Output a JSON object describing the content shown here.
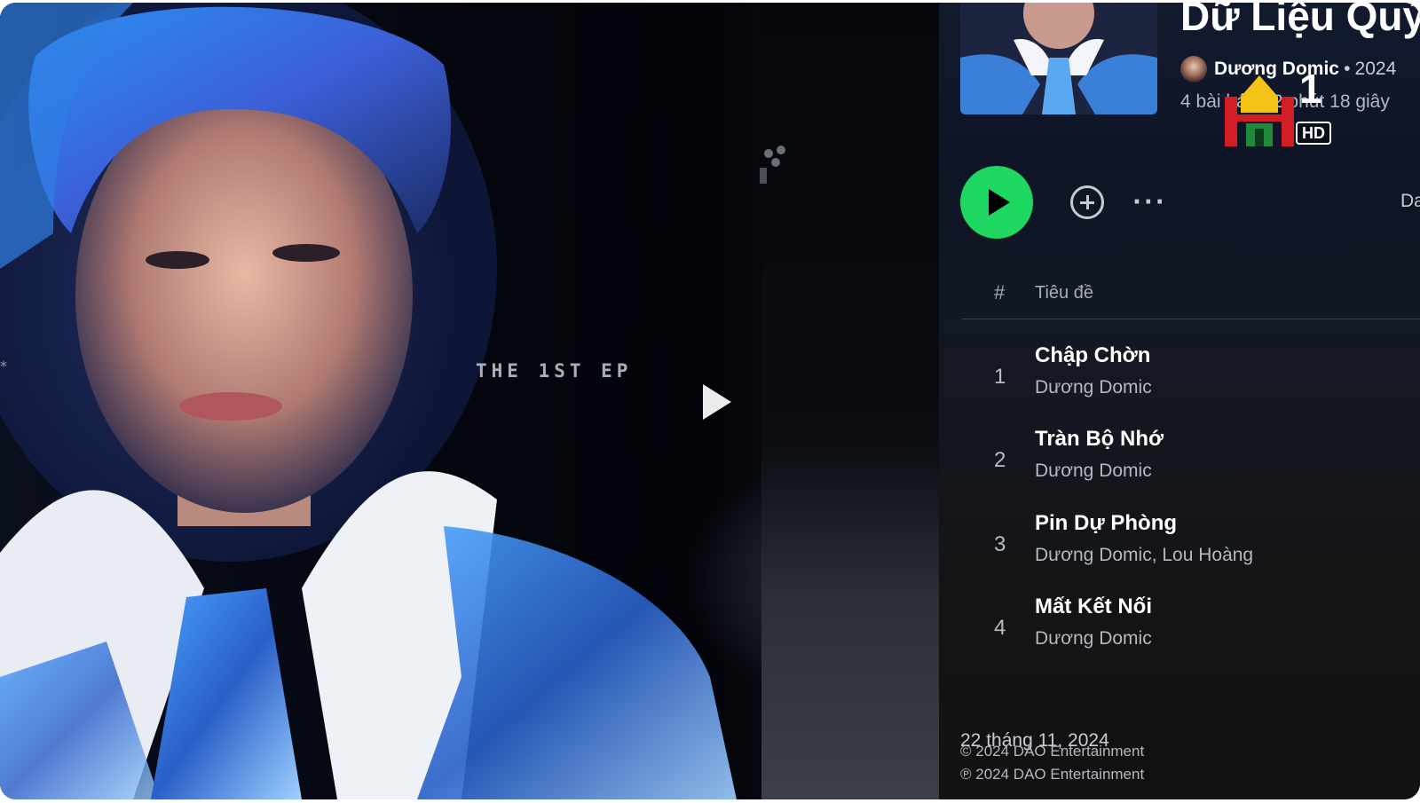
{
  "video": {
    "ep_text": "THE 1ST EP",
    "side_glyph": "*"
  },
  "album": {
    "title": "Dữ Liệu Quý",
    "artist": "Dương Domic",
    "separator": "•",
    "year": "2024",
    "summary": "4 bài hát, 12 phút 18 giây"
  },
  "controls": {
    "more": "···",
    "list_view": "Danh sách"
  },
  "track_header": {
    "hash": "#",
    "title": "Tiêu đề"
  },
  "tracks": [
    {
      "number": "1",
      "title": "Chập Chờn",
      "artist": "Dương Domic"
    },
    {
      "number": "2",
      "title": "Tràn Bộ Nhớ",
      "artist": "Dương Domic"
    },
    {
      "number": "3",
      "title": "Pin Dự Phòng",
      "artist": "Dương Domic, Lou Hoàng"
    },
    {
      "number": "4",
      "title": "Mất Kết Nối",
      "artist": "Dương Domic"
    }
  ],
  "footer": {
    "release_date": "22 tháng 11, 2024",
    "copyright_c": "© 2024 DAO Entertainment",
    "copyright_p": "℗ 2024 DAO Entertainment"
  },
  "channel": {
    "number": "1",
    "quality": "HD"
  },
  "colors": {
    "play_green": "#1ed760",
    "logo_red": "#d21f26",
    "logo_yellow": "#f3c316",
    "logo_green": "#1f8a3b"
  },
  "icons": [
    "play-icon",
    "add-icon",
    "more-icon",
    "video-play-icon",
    "channel-logo"
  ]
}
